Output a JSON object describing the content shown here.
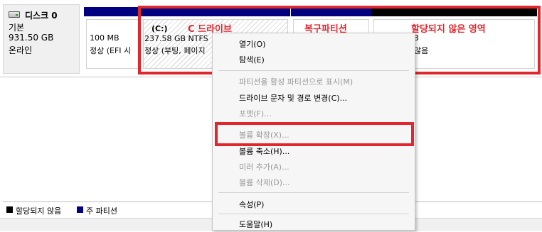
{
  "disk": {
    "name": "디스크 0",
    "type": "기본",
    "size": "931.50 GB",
    "status": "온라인"
  },
  "partitions": [
    {
      "size": "100 MB",
      "status": "정상 (EFI 시",
      "color": "#000080"
    },
    {
      "drive": "(C:)",
      "size": "237.58 GB NTFS",
      "status": "정상 (부팅, 페이지",
      "color": "#000080"
    },
    {
      "color": "#000080"
    },
    {
      "size": "3",
      "status": "않음",
      "color": "#000000"
    }
  ],
  "annotations": {
    "c_drive": "C 드라이브",
    "recovery": "복구파티션",
    "unallocated": "할당되지 않은 영역",
    "accent": "#e0262e"
  },
  "context_menu": {
    "items": [
      {
        "label": "열기(O)",
        "enabled": true
      },
      {
        "label": "탐색(E)",
        "enabled": true
      },
      {
        "label": "파티션을 활성 파티션으로 표시(M)",
        "enabled": false
      },
      {
        "label": "드라이브 문자 및 경로 변경(C)...",
        "enabled": true
      },
      {
        "label": "포맷(F)...",
        "enabled": false
      },
      {
        "label": "볼륨 확장(X)...",
        "enabled": false
      },
      {
        "label": "볼륨 축소(H)...",
        "enabled": true
      },
      {
        "label": "미러 추가(A)...",
        "enabled": false
      },
      {
        "label": "볼륨 삭제(D)...",
        "enabled": false
      },
      {
        "label": "속성(P)",
        "enabled": true
      },
      {
        "label": "도움말(H)",
        "enabled": true
      }
    ]
  },
  "legend": [
    {
      "label": "할당되지 않음",
      "color": "#000000"
    },
    {
      "label": "주 파티션",
      "color": "#000080"
    }
  ]
}
